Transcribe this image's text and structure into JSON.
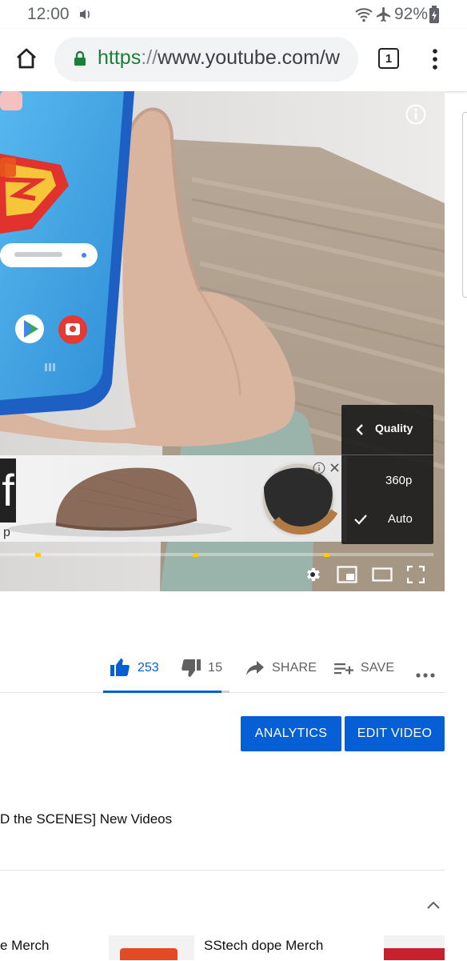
{
  "status_bar": {
    "time": "12:00",
    "battery": "92%"
  },
  "browser": {
    "url_scheme": "https",
    "url_separator": "://",
    "url_rest": "www.youtube.com/w",
    "tab_count": "1"
  },
  "player": {
    "quality_menu": {
      "title": "Quality",
      "options": [
        "360p",
        "Auto"
      ],
      "selected": "Auto"
    },
    "ad": {
      "logo_text": "f",
      "tagline": "p"
    }
  },
  "actions": {
    "like_count": "253",
    "dislike_count": "15",
    "share_label": "SHARE",
    "save_label": "SAVE"
  },
  "owner_buttons": {
    "analytics": "ANALYTICS",
    "edit_video": "EDIT VIDEO"
  },
  "description": {
    "playlist_text": "D the SCENES] New Videos"
  },
  "merch": {
    "item_left_title": "e Merch",
    "item_middle_title": "SStech dope Merch"
  },
  "colors": {
    "youtube_blue": "#065fd4",
    "secure_green": "#188038",
    "ad_marker_yellow": "#ffcc00"
  }
}
